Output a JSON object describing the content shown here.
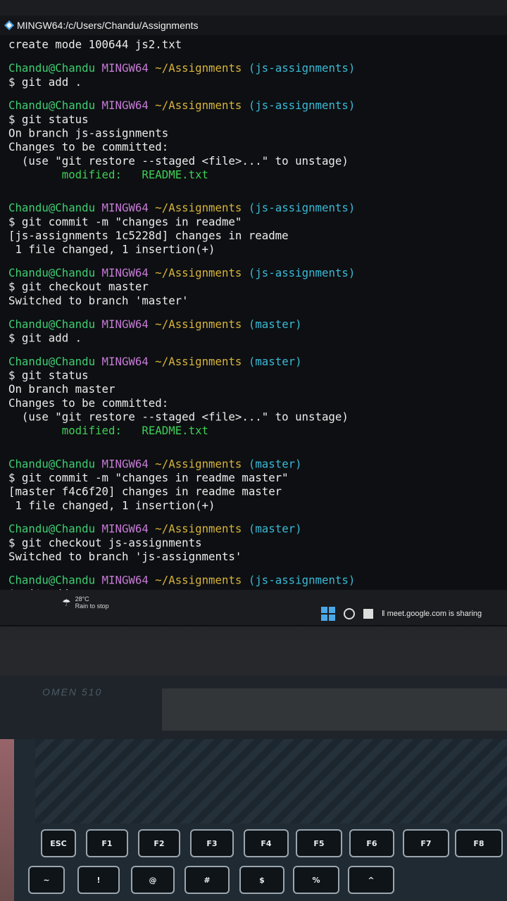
{
  "window": {
    "title": "MINGW64:/c/Users/Chandu/Assignments"
  },
  "terminal": {
    "lines": [
      {
        "type": "out",
        "text": "create mode 100644 js2.txt"
      },
      {
        "type": "gap"
      },
      {
        "type": "prompt",
        "user": "Chandu@Chandu",
        "sys": "MINGW64",
        "path": "~/Assignments",
        "branch": "(js-assignments)"
      },
      {
        "type": "out",
        "text": "$ git add ."
      },
      {
        "type": "gap"
      },
      {
        "type": "prompt",
        "user": "Chandu@Chandu",
        "sys": "MINGW64",
        "path": "~/Assignments",
        "branch": "(js-assignments)"
      },
      {
        "type": "out",
        "text": "$ git status"
      },
      {
        "type": "out",
        "text": "On branch js-assignments"
      },
      {
        "type": "out",
        "text": "Changes to be committed:"
      },
      {
        "type": "out",
        "text": "  (use \"git restore --staged <file>...\" to unstage)"
      },
      {
        "type": "mod",
        "label": "modified:",
        "file": "README.txt"
      },
      {
        "type": "gap"
      },
      {
        "type": "gap"
      },
      {
        "type": "prompt",
        "user": "Chandu@Chandu",
        "sys": "MINGW64",
        "path": "~/Assignments",
        "branch": "(js-assignments)"
      },
      {
        "type": "out",
        "text": "$ git commit -m \"changes in readme\""
      },
      {
        "type": "out",
        "text": "[js-assignments 1c5228d] changes in readme"
      },
      {
        "type": "out",
        "text": " 1 file changed, 1 insertion(+)"
      },
      {
        "type": "gap"
      },
      {
        "type": "prompt",
        "user": "Chandu@Chandu",
        "sys": "MINGW64",
        "path": "~/Assignments",
        "branch": "(js-assignments)"
      },
      {
        "type": "out",
        "text": "$ git checkout master"
      },
      {
        "type": "out",
        "text": "Switched to branch 'master'"
      },
      {
        "type": "gap"
      },
      {
        "type": "prompt",
        "user": "Chandu@Chandu",
        "sys": "MINGW64",
        "path": "~/Assignments",
        "branch": "(master)"
      },
      {
        "type": "out",
        "text": "$ git add ."
      },
      {
        "type": "gap"
      },
      {
        "type": "prompt",
        "user": "Chandu@Chandu",
        "sys": "MINGW64",
        "path": "~/Assignments",
        "branch": "(master)"
      },
      {
        "type": "out",
        "text": "$ git status"
      },
      {
        "type": "out",
        "text": "On branch master"
      },
      {
        "type": "out",
        "text": "Changes to be committed:"
      },
      {
        "type": "out",
        "text": "  (use \"git restore --staged <file>...\" to unstage)"
      },
      {
        "type": "mod",
        "label": "modified:",
        "file": "README.txt"
      },
      {
        "type": "gap"
      },
      {
        "type": "gap"
      },
      {
        "type": "prompt",
        "user": "Chandu@Chandu",
        "sys": "MINGW64",
        "path": "~/Assignments",
        "branch": "(master)"
      },
      {
        "type": "out",
        "text": "$ git commit -m \"changes in readme master\""
      },
      {
        "type": "out",
        "text": "[master f4c6f20] changes in readme master"
      },
      {
        "type": "out",
        "text": " 1 file changed, 1 insertion(+)"
      },
      {
        "type": "gap"
      },
      {
        "type": "prompt",
        "user": "Chandu@Chandu",
        "sys": "MINGW64",
        "path": "~/Assignments",
        "branch": "(master)"
      },
      {
        "type": "out",
        "text": "$ git checkout js-assignments"
      },
      {
        "type": "out",
        "text": "Switched to branch 'js-assignments'"
      },
      {
        "type": "gap"
      },
      {
        "type": "prompt",
        "user": "Chandu@Chandu",
        "sys": "MINGW64",
        "path": "~/Assignments",
        "branch": "(js-assignments)"
      },
      {
        "type": "out",
        "text": "$ git add ."
      }
    ]
  },
  "taskbar": {
    "weather_temp": "28°C",
    "weather_desc": "Rain to stop",
    "share_text": "meet.google.com is sharing"
  },
  "laptop": {
    "brand": "OMEN 510",
    "keys": [
      "ESC",
      "F1",
      "F2",
      "F3",
      "F4",
      "F5",
      "F6",
      "F7",
      "F8",
      "~",
      "!",
      "@",
      "#",
      "$",
      "%",
      "^"
    ]
  },
  "colors": {
    "user": "#3ecf73",
    "system": "#c77bd6",
    "path": "#d8b43b",
    "branch": "#3bbad6",
    "modified": "#3fcf55"
  }
}
